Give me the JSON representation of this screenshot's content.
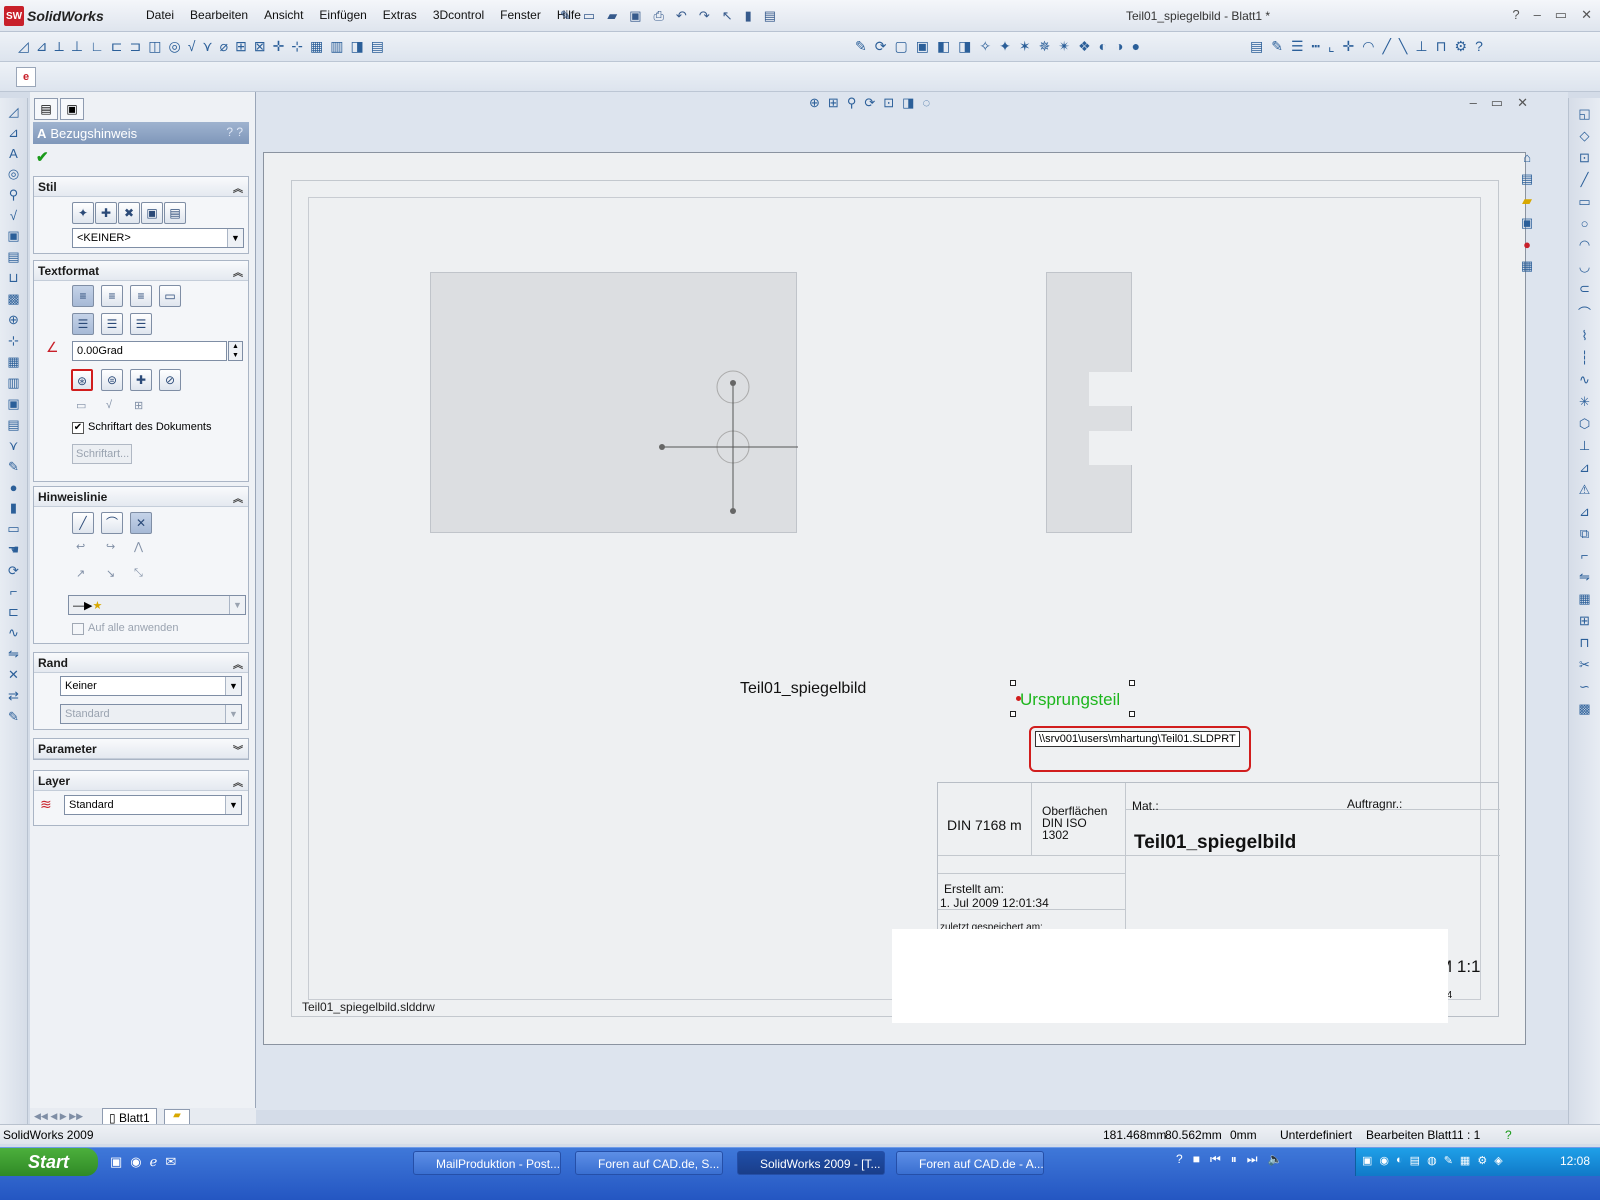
{
  "app": {
    "logo": "SolidWorks",
    "doc_title": "Teil01_spiegelbild - Blatt1 *"
  },
  "menu": [
    "Datei",
    "Bearbeiten",
    "Ansicht",
    "Einfügen",
    "Extras",
    "3Dcontrol",
    "Fenster",
    "Hilfe"
  ],
  "window_controls": [
    "?",
    "–",
    "▭",
    "✕"
  ],
  "propertymanager": {
    "title": "Bezugshinweis",
    "help": "? ?",
    "ok": "✔",
    "stil": {
      "header": "Stil",
      "select": "<KEINER>"
    },
    "textformat": {
      "header": "Textformat",
      "angle": "0.00Grad",
      "font_doc_checkbox": "Schriftart des Dokuments",
      "font_button": "Schriftart..."
    },
    "hinweislinie": {
      "header": "Hinweislinie",
      "apply_all": "Auf alle anwenden"
    },
    "rand": {
      "header": "Rand",
      "select1": "Keiner",
      "select2": "Standard"
    },
    "parameter": {
      "header": "Parameter"
    },
    "layer": {
      "header": "Layer",
      "select": "Standard"
    }
  },
  "drawing": {
    "view_label": "Teil01_spiegelbild",
    "note": "Ursprungsteil",
    "tooltip": "\\\\srv001\\users\\mhartung\\Teil01.SLDPRT",
    "filename": "Teil01_spiegelbild.slddrw",
    "titleblock": {
      "din": "DIN 7168 m",
      "surfaces": "Oberflächen\nDIN ISO\n1302",
      "mat": "Mat.:",
      "order": "Auftragnr.:",
      "part": "Teil01_spiegelbild",
      "created_label": "Erstellt am:",
      "created_date": "1. Jul 2009 12:01:34",
      "saved_label": "zuletzt gespeichert am:",
      "scale": "M 1:1",
      "format": "A4"
    }
  },
  "sheet_tab": "Blatt1",
  "status": {
    "app": "SolidWorks 2009",
    "x": "181.468mm",
    "y": "80.562mm",
    "z": "0mm",
    "state": "Unterdefiniert",
    "edit": "Bearbeiten Blatt1",
    "scale": "1 : 1"
  },
  "taskbar": {
    "start": "Start",
    "tasks": [
      "MailProduktion - Post...",
      "Foren auf CAD.de, S...",
      "SolidWorks 2009 - [T...",
      "Foren auf CAD.de - A..."
    ],
    "clock": "12:08"
  },
  "colors": {
    "note_green": "#1db61d",
    "highlight_red": "#d11d1d",
    "pm_header": "#7f97ba"
  }
}
